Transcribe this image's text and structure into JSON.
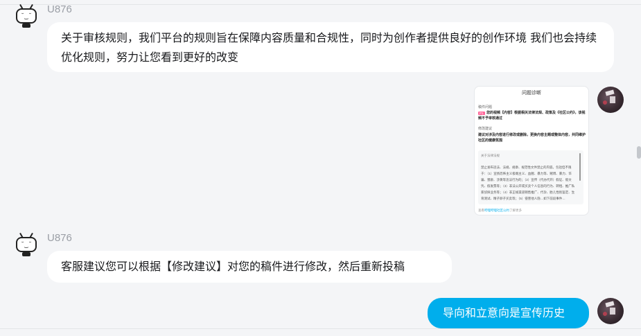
{
  "messages": [
    {
      "sender": "U876",
      "avatar_icon": "tv-robot-icon",
      "text": "关于审核规则，我们平台的规则旨在保障内容质量和合规性，同时为创作者提供良好的创作环境 我们也会持续优化规则，努力让您看到更好的改变"
    },
    {
      "sender_side": "self",
      "type": "image",
      "image": {
        "title": "问题诊断",
        "problem_label": "稿件问题",
        "problem_tag": "P1",
        "problem_text": "您的视频【内容】根据相关法律法规、政策及《社区公约》，该视频不予审核通过",
        "suggestion_label": "修改建议",
        "suggestion_text": "建议对涉及内容进行修改或删除，更换内容主题或整体内容，共同维护社区的健康氛围",
        "rule_title": "关于法律法规",
        "rule_body": "禁止发布违法、法规、规章、规范性文件禁止的内容。包括但不限于：（1）宣扬恐怖主义极端主义、血腥、暴力等、赌博、暴力、诈骗、猥亵、涉黄等违法行为的；（2）宣传（代办代开）假证、假文凭、假发票等；（3）非法公开或买卖个人信息的行为、转租、推广私家侦探业务等；（4）非正规渠道销售推广、代孕、胎儿性别鉴定、生育测试、精子卵子买卖等；（5）侵害他人隐…如下前段事件…",
        "foot_prefix": "查看",
        "foot_link": "哔哩哔哩社区公约",
        "foot_suffix": "了解更多"
      }
    },
    {
      "sender": "U876",
      "avatar_icon": "tv-robot-icon",
      "text": "客服建议您可以根据【修改建议】对您的稿件进行修改，然后重新投稿"
    },
    {
      "sender_side": "self",
      "text": "导向和立意向是宣传历史"
    }
  ],
  "colors": {
    "background": "#f4f5f7",
    "outgoing_bubble": "#00aeec",
    "incoming_bubble": "#ffffff",
    "username": "#9a9ea5"
  }
}
